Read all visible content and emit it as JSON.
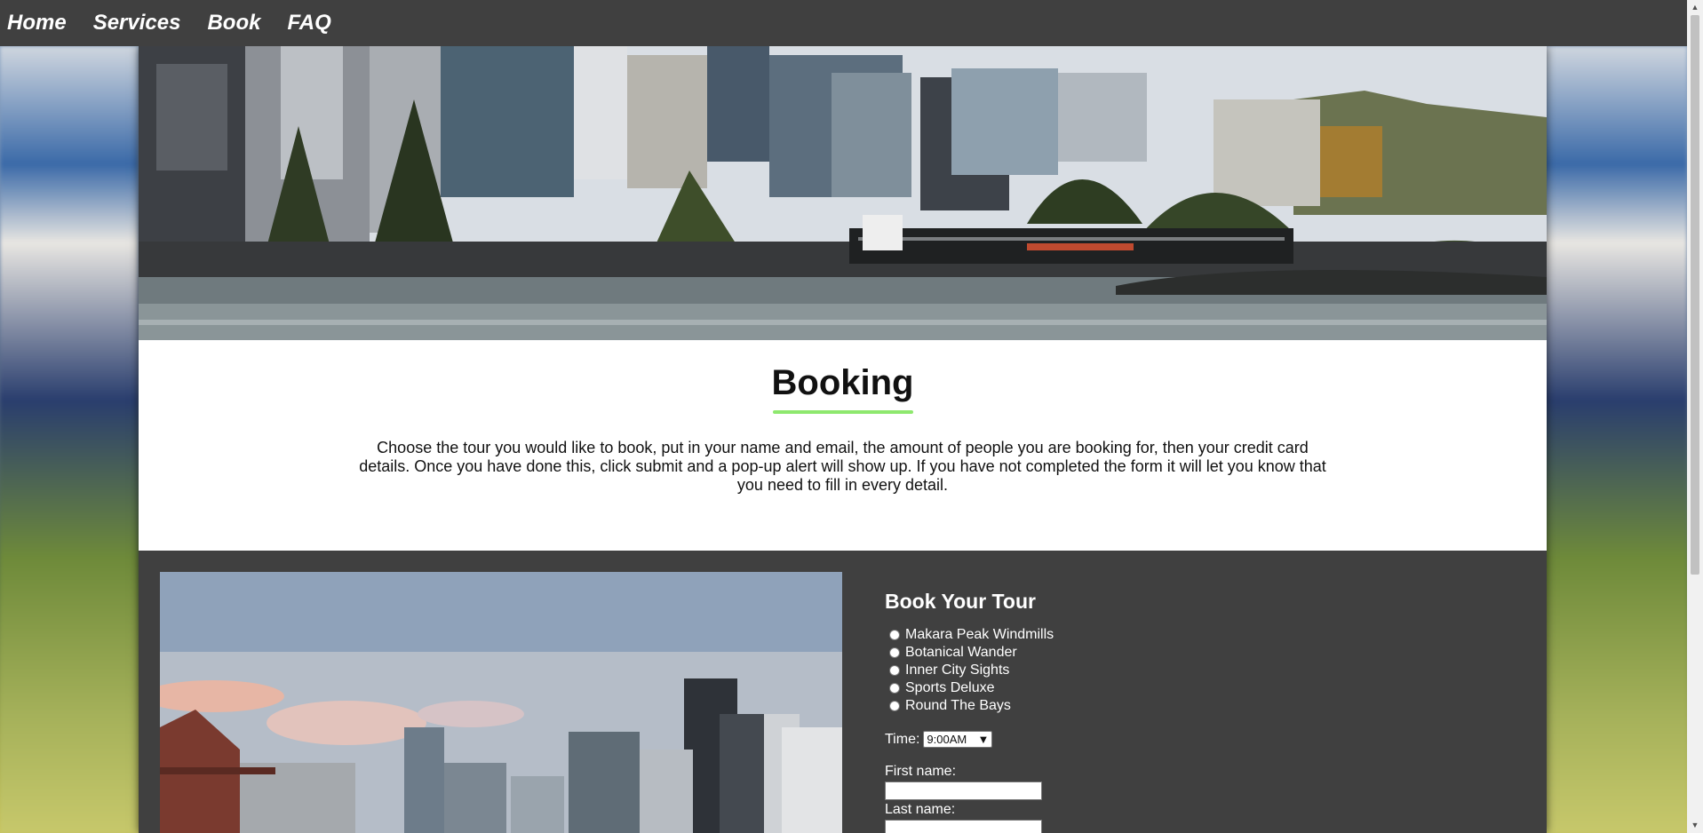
{
  "nav": {
    "items": [
      {
        "label": "Home"
      },
      {
        "label": "Services"
      },
      {
        "label": "Book"
      },
      {
        "label": "FAQ"
      }
    ]
  },
  "intro": {
    "title": "Booking",
    "description": "Choose the tour you would like to book, put in your name and email, the amount of people you are booking for, then your credit card details. Once you have done this, click submit and a pop-up alert will show up. If you have not completed the form it will let you know that you need to fill in every detail."
  },
  "form": {
    "heading": "Book Your Tour",
    "tours": [
      {
        "label": "Makara Peak Windmills"
      },
      {
        "label": "Botanical Wander"
      },
      {
        "label": "Inner City Sights"
      },
      {
        "label": "Sports Deluxe"
      },
      {
        "label": "Round The Bays"
      }
    ],
    "time_label": "Time:",
    "time_value": "9:00AM",
    "first_name_label": "First name:",
    "first_name_value": "",
    "last_name_label": "Last name:",
    "last_name_value": ""
  },
  "colors": {
    "nav_bg": "#404040",
    "accent_underline": "#8ee86e",
    "form_bg": "#404040"
  },
  "icons": {
    "scroll_up": "triangle-up-icon",
    "scroll_down": "triangle-down-icon",
    "select_arrow": "chevron-down-icon"
  }
}
